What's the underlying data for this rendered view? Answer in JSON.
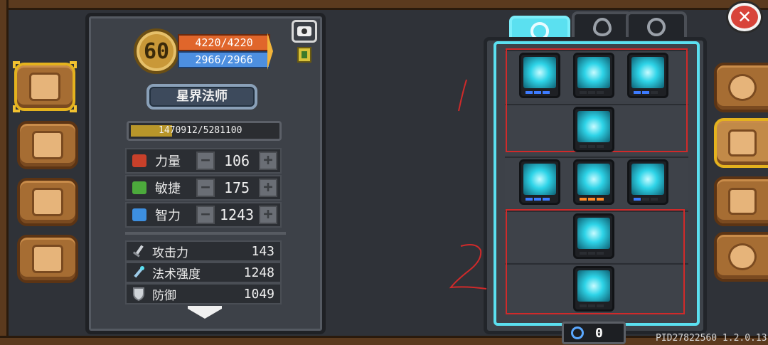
{
  "player": {
    "level": "60",
    "hp": "4220/4220",
    "mp": "2966/2966",
    "class_name": "星界法师",
    "xp": "1470912/5281100",
    "xp_fraction": 0.28
  },
  "attributes": [
    {
      "name": "力量",
      "value": "106",
      "color": "#c8402a"
    },
    {
      "name": "敏捷",
      "value": "175",
      "color": "#4caa3c"
    },
    {
      "name": "智力",
      "value": "1243",
      "color": "#3d8fe0"
    }
  ],
  "attribute_controls": {
    "minus": "−",
    "plus": "+"
  },
  "stats": [
    {
      "name": "攻击力",
      "value": "143"
    },
    {
      "name": "法术强度",
      "value": "1248"
    },
    {
      "name": "防御",
      "value": "1049"
    }
  ],
  "skill_tabs": [
    {
      "icon": "spiral-icon",
      "active": true
    },
    {
      "icon": "eye-icon",
      "active": false
    },
    {
      "icon": "vortex-icon",
      "active": false
    }
  ],
  "skill_tree": {
    "rows": [
      {
        "skills": [
          {
            "icon": "mana-circuit-icon",
            "pips": [
              1,
              1,
              1
            ]
          },
          {
            "icon": "shard-icon",
            "pips": [
              0,
              0,
              0
            ]
          },
          {
            "icon": "heal-cross-icon",
            "pips": [
              1,
              1,
              0
            ]
          }
        ]
      },
      {
        "skills": [
          {
            "icon": "lightning-storm-icon",
            "pips": [
              0,
              0,
              0
            ]
          }
        ]
      },
      {
        "skills": [
          {
            "icon": "frost-dragon-icon",
            "pips": [
              1,
              1,
              1
            ]
          },
          {
            "icon": "arcane-burst-icon",
            "pips": [
              2,
              2,
              2
            ]
          },
          {
            "icon": "shield-icon",
            "pips": [
              1,
              0,
              0
            ]
          }
        ]
      },
      {
        "skills": [
          {
            "icon": "nova-icon",
            "pips": [
              0,
              0,
              0
            ]
          }
        ]
      },
      {
        "skills": [
          {
            "icon": "blizzard-icon",
            "pips": [
              0,
              0,
              0
            ]
          }
        ]
      }
    ]
  },
  "skill_points": "0",
  "annotations": {
    "one": "1",
    "two": "2"
  },
  "build_id": "PID27822560 1.2.0.13",
  "close_label": "✕",
  "colors": {
    "accent": "#5be0f0",
    "hp": "#e0662b",
    "mp": "#4d8fe0",
    "annotation": "#d02a2a"
  }
}
